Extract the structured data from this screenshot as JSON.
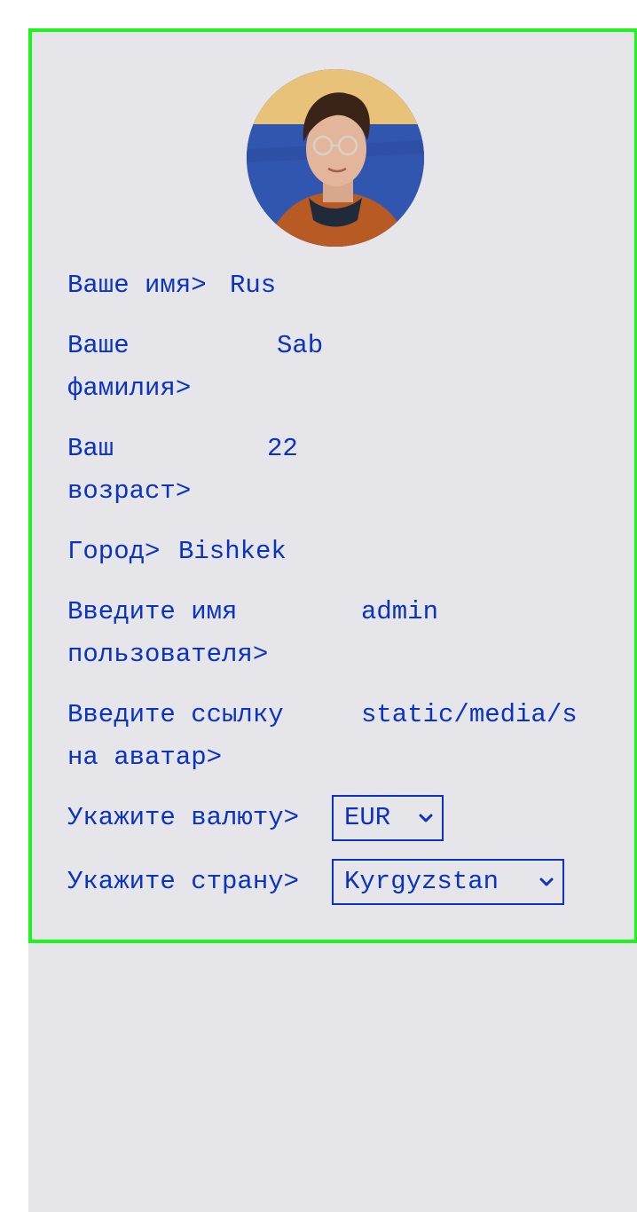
{
  "profile": {
    "avatar_alt": "profile photo",
    "fields": {
      "first_name": {
        "label": "Ваше имя>",
        "value": "Rus"
      },
      "last_name": {
        "label_line1": "Ваше",
        "label_line2": "фамилия>",
        "value": "Sab"
      },
      "age": {
        "label_line1": "Ваш",
        "label_line2": "возраст>",
        "value": "22"
      },
      "city": {
        "label": "Город>",
        "value": "Bishkek"
      },
      "username": {
        "label_line1": "Введите имя",
        "label_line2": "пользователя>",
        "value": "admin"
      },
      "avatar_link": {
        "label_line1": "Введите ссылку",
        "label_line2": "на аватар>",
        "value": "static/media/s"
      },
      "currency": {
        "label": "Укажите валюту>",
        "selected": "EUR"
      },
      "country": {
        "label": "Укажите страну>",
        "selected": "Kyrgyzstan"
      }
    }
  },
  "colors": {
    "accent": "#0a33c2",
    "card_border": "#1df51d",
    "background": "#e6e5e9"
  }
}
